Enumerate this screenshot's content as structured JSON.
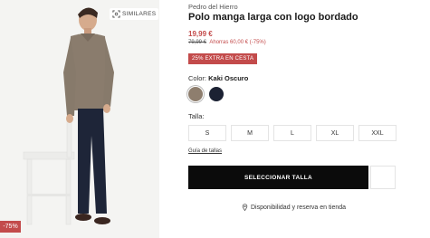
{
  "product_image": {
    "similar_label": "SIMILARES",
    "discount_badge": "-75%"
  },
  "product": {
    "brand": "Pedro del Hierro",
    "title": "Polo manga larga con logo bordado",
    "price": "19,99 €",
    "old_price": "79,99 €",
    "savings": "Ahorras 60,00 € (-75%)",
    "promo": "25% EXTRA EN CESTA"
  },
  "color": {
    "label": "Color:",
    "selected": "Kaki Oscuro",
    "swatches": [
      {
        "name": "Kaki Oscuro",
        "hex": "#8e7e6e"
      },
      {
        "name": "navy",
        "hex": "#1c2233"
      }
    ]
  },
  "size": {
    "label": "Talla:",
    "options": [
      "S",
      "M",
      "L",
      "XL",
      "XXL"
    ],
    "guide": "Guía de tallas"
  },
  "actions": {
    "select_size": "SELECCIONAR TALLA",
    "store_availability": "Disponibilidad y reserva en tienda"
  }
}
